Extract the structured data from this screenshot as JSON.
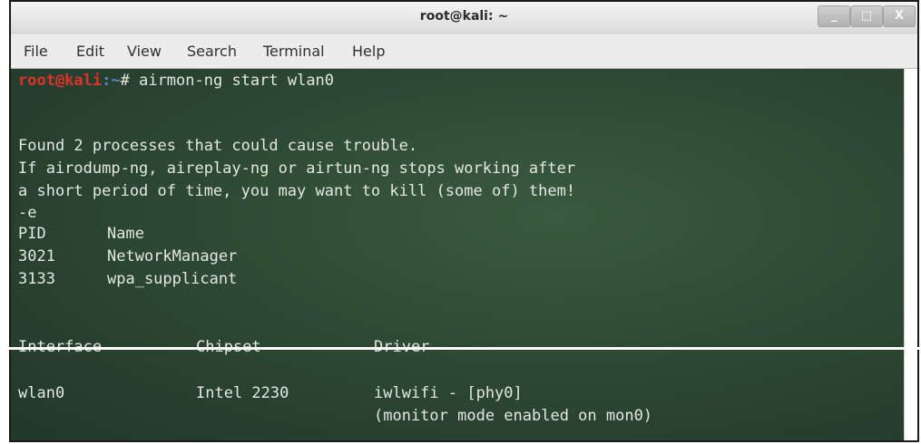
{
  "window": {
    "title": "root@kali: ~",
    "controls": {
      "minimize": "_",
      "maximize": "□",
      "close": "X"
    }
  },
  "menu": [
    "File",
    "Edit",
    "View",
    "Search",
    "Terminal",
    "Help"
  ],
  "terminal": {
    "prompt": {
      "user": "root@kali",
      "path": ":~",
      "symbol": "#",
      "command": " airmon-ng start wlan0"
    },
    "messages": [
      "Found 2 processes that could cause trouble.",
      "If airodump-ng, aireplay-ng or airtun-ng stops working after",
      "a short period of time, you may want to kill (some of) them!",
      "-e"
    ],
    "process_table": {
      "headers": [
        "PID",
        "Name"
      ],
      "rows": [
        [
          "3021",
          "NetworkManager"
        ],
        [
          "3133",
          "wpa_supplicant"
        ]
      ]
    },
    "interface_table": {
      "headers": [
        "Interface",
        "Chipset",
        "Driver"
      ],
      "rows": [
        {
          "interface": "wlan0",
          "chipset": "Intel 2230",
          "driver": "iwlwifi - [phy0]",
          "note": "(monitor mode enabled on mon0)"
        }
      ]
    }
  }
}
